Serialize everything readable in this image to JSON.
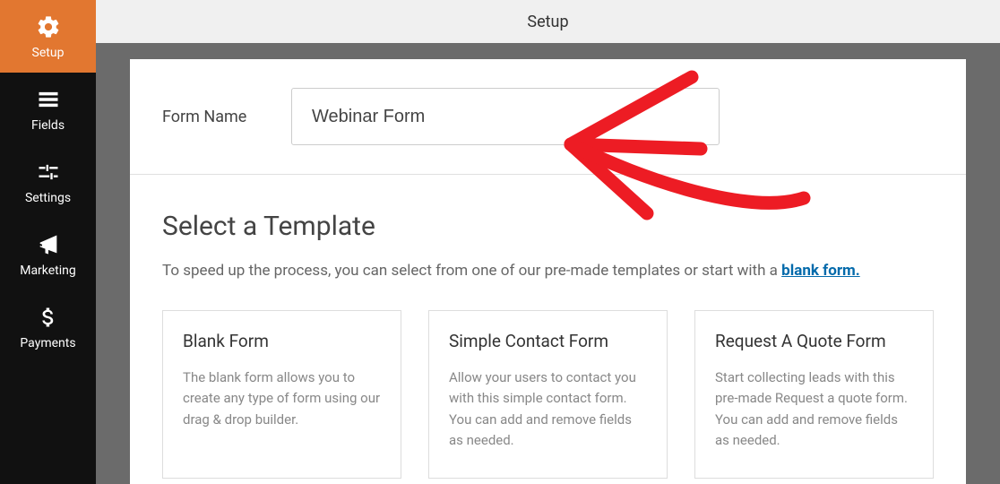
{
  "header": {
    "title": "Setup"
  },
  "sidebar": {
    "items": [
      {
        "label": "Setup"
      },
      {
        "label": "Fields"
      },
      {
        "label": "Settings"
      },
      {
        "label": "Marketing"
      },
      {
        "label": "Payments"
      }
    ]
  },
  "form_name": {
    "label": "Form Name",
    "value": "Webinar Form"
  },
  "templates": {
    "heading": "Select a Template",
    "subtext_prefix": "To speed up the process, you can select from one of our pre-made templates or start with a ",
    "blank_link": "blank form.",
    "cards": [
      {
        "title": "Blank Form",
        "desc": "The blank form allows you to create any type of form using our drag & drop builder."
      },
      {
        "title": "Simple Contact Form",
        "desc": "Allow your users to contact you with this simple contact form. You can add and remove fields as needed."
      },
      {
        "title": "Request A Quote Form",
        "desc": "Start collecting leads with this pre-made Request a quote form. You can add and remove fields as needed."
      }
    ]
  }
}
